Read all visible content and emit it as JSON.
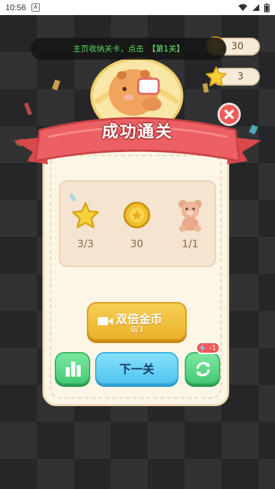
{
  "status_bar": {
    "time": "10:56",
    "app_indicator": "A"
  },
  "hud": {
    "coins_value": "30",
    "stars_value": "3"
  },
  "toast": {
    "text": "主页收纳关卡，点击",
    "highlight": "【第1关】"
  },
  "title": "成功通关",
  "rewards": [
    {
      "icon": "star-icon",
      "value": "3/3"
    },
    {
      "icon": "coin-icon",
      "value": "30"
    },
    {
      "icon": "teddy-bear-icon",
      "value": "1/1"
    }
  ],
  "buttons": {
    "double_coins_label": "双倍金币",
    "double_coins_count": "0/1",
    "next_level_label": "下一关",
    "refresh_badge": "-1"
  },
  "colors": {
    "ribbon": "#e9595c",
    "gold_button": "#f0bf3a",
    "blue_button": "#6fd4f7",
    "green_button": "#5fd789",
    "panel": "#fdf6e7"
  }
}
